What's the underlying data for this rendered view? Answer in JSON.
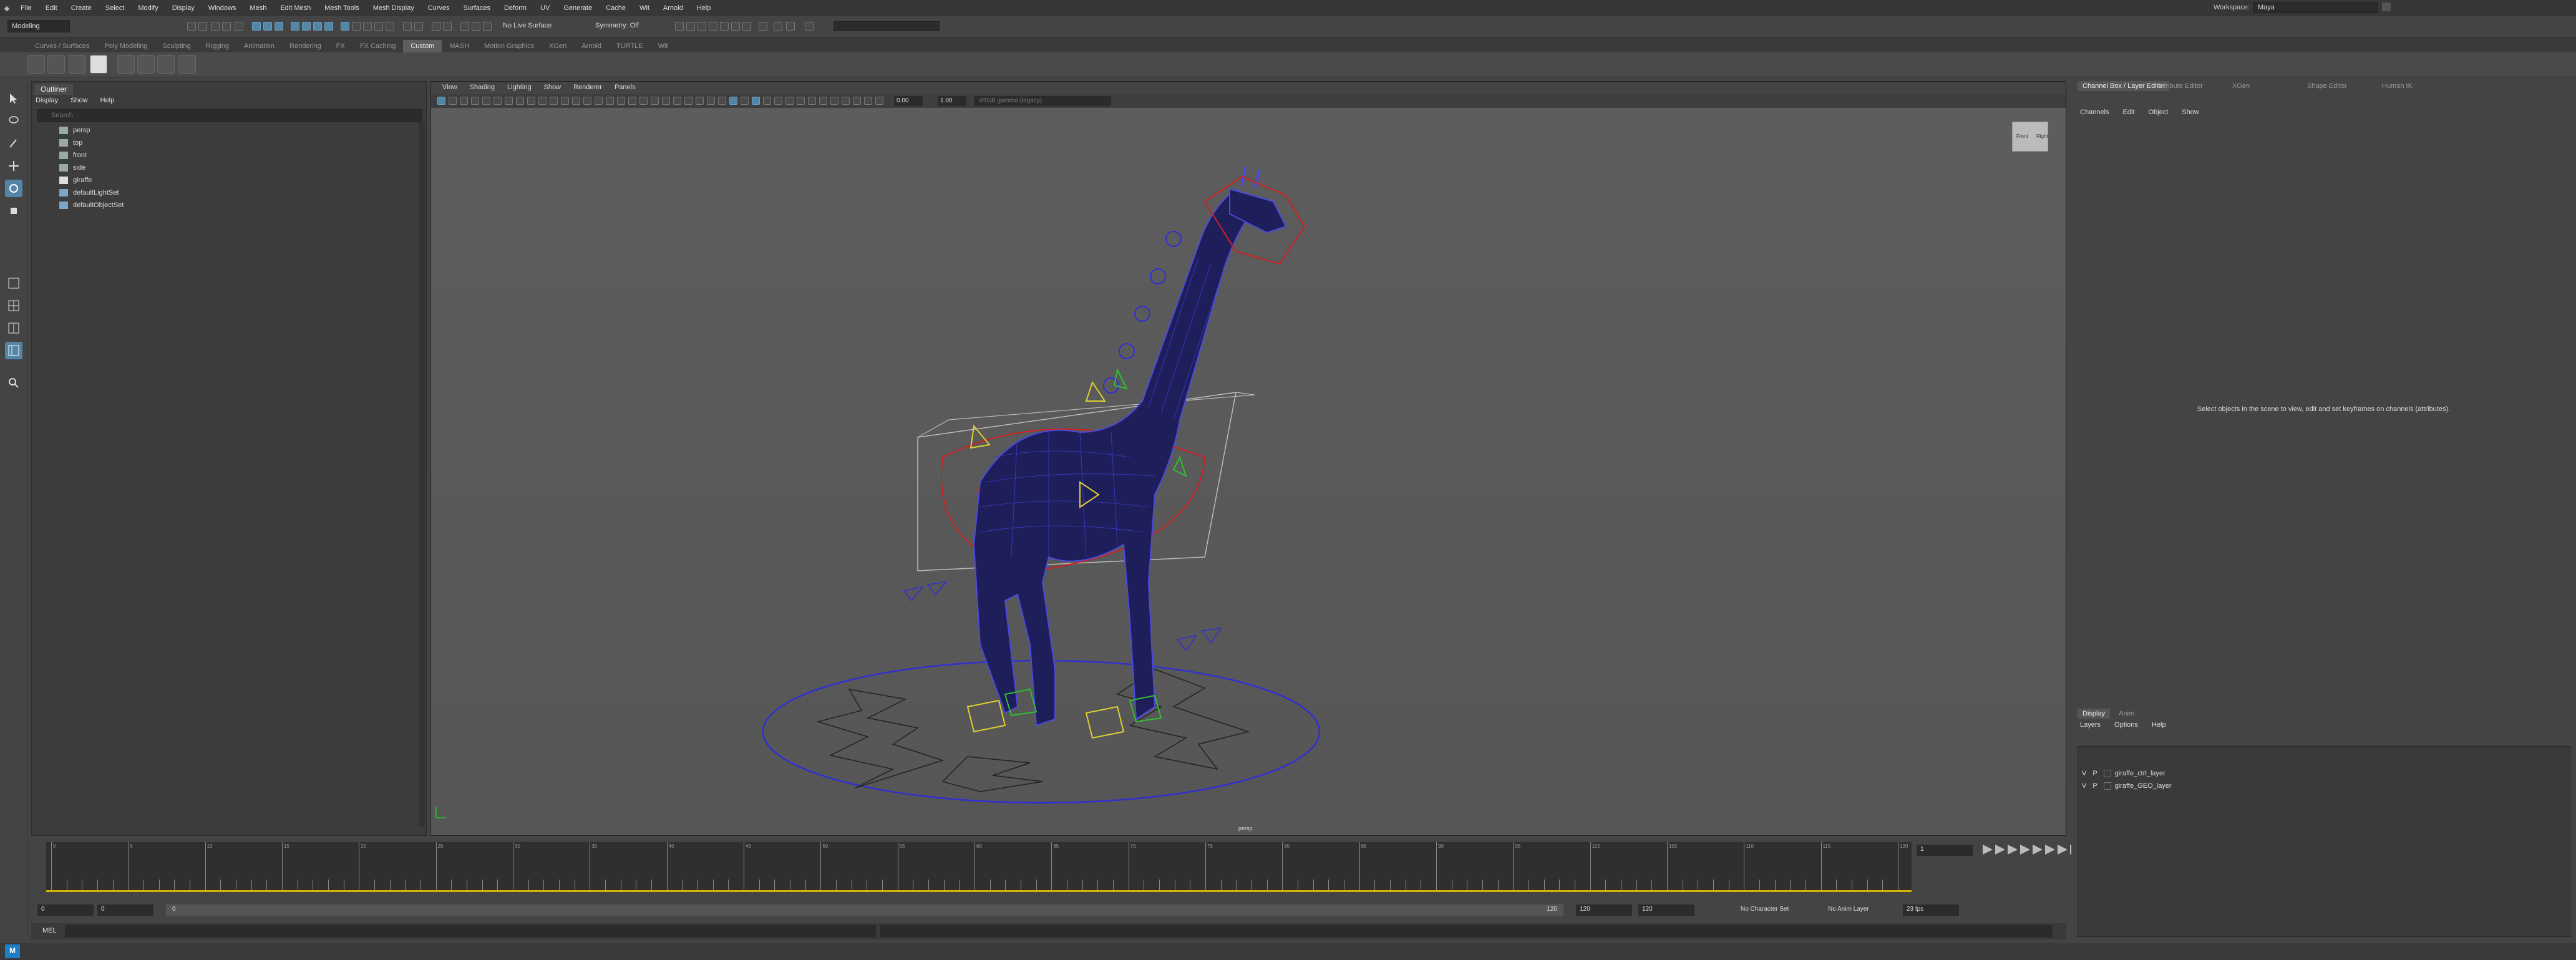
{
  "menubar": {
    "items": [
      "File",
      "Edit",
      "Create",
      "Select",
      "Modify",
      "Display",
      "Windows",
      "Mesh",
      "Edit Mesh",
      "Mesh Tools",
      "Mesh Display",
      "Curves",
      "Surfaces",
      "Deform",
      "UV",
      "Generate",
      "Cache",
      "Wit",
      "Arnold",
      "Help"
    ],
    "workspace_label": "Workspace:",
    "workspace_value": "Maya"
  },
  "statusline": {
    "mode": "Modeling",
    "live_surface": "No Live Surface",
    "symmetry": "Symmetry: Off"
  },
  "shelf": {
    "tabs": [
      "Curves / Surfaces",
      "Poly Modeling",
      "Sculpting",
      "Rigging",
      "Animation",
      "Rendering",
      "FX",
      "FX Caching",
      "Custom",
      "MASH",
      "Motion Graphics",
      "XGen",
      "Arnold",
      "TURTLE",
      "Wit"
    ],
    "active_tab": "Custom"
  },
  "outliner": {
    "title": "Outliner",
    "menu": [
      "Display",
      "Show",
      "Help"
    ],
    "search_placeholder": "Search...",
    "items": [
      {
        "label": "persp",
        "type": "camera"
      },
      {
        "label": "top",
        "type": "camera"
      },
      {
        "label": "front",
        "type": "camera"
      },
      {
        "label": "side",
        "type": "camera"
      },
      {
        "label": "giraffe",
        "type": "group"
      },
      {
        "label": "defaultLightSet",
        "type": "set"
      },
      {
        "label": "defaultObjectSet",
        "type": "set"
      }
    ]
  },
  "viewport": {
    "menu": [
      "View",
      "Shading",
      "Lighting",
      "Show",
      "Renderer",
      "Panels"
    ],
    "value_a": "0.00",
    "value_b": "1.00",
    "colorspace": "sRGB gamma (legacy)",
    "camera_label": "persp",
    "viewcube_label_front": "Front",
    "viewcube_label_right": "Right"
  },
  "timeslider": {
    "ticks": [
      "0",
      "5",
      "10",
      "15",
      "20",
      "25",
      "30",
      "35",
      "40",
      "45",
      "50",
      "55",
      "60",
      "65",
      "70",
      "75",
      "80",
      "85",
      "90",
      "95",
      "100",
      "105",
      "110",
      "115",
      "120"
    ],
    "current_frame": "1"
  },
  "rangebar": {
    "start": "0",
    "start_inner": "0",
    "slider_start": "0",
    "slider_end": "120",
    "end_inner": "120",
    "end": "120",
    "character_set": "No Character Set",
    "anim_layer": "No Anim Layer",
    "fps": "23 fps"
  },
  "cmdline": {
    "label": "MEL"
  },
  "rightpanel": {
    "tabs": [
      "Channel Box / Layer Editor",
      "Attribute Editor",
      "XGen",
      "Shape Editor",
      "Human IK"
    ],
    "menu": [
      "Channels",
      "Edit",
      "Object",
      "Show"
    ],
    "empty_message": "Select objects in the scene to view, edit and set keyframes on channels (attributes).",
    "layer_tabs": [
      "Display",
      "Anim"
    ],
    "layer_menu": [
      "Layers",
      "Options",
      "Help"
    ],
    "layers": [
      {
        "v": "V",
        "p": "P",
        "name": "giraffe_ctrl_layer"
      },
      {
        "v": "V",
        "p": "P",
        "name": "giraffe_GEO_layer"
      }
    ]
  },
  "colors": {
    "accent": "#5285a6",
    "mesh": "#1e1e5a",
    "wire": "#4a4adf",
    "control_red": "#d02020",
    "control_yellow": "#e0d030",
    "control_green": "#30c030"
  }
}
